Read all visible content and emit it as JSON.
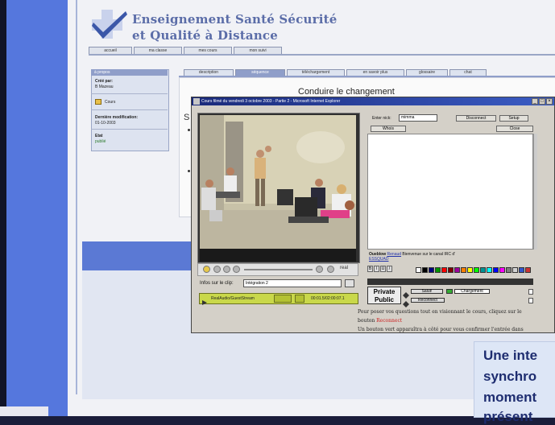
{
  "site": {
    "title_line1": "Enseignement Santé Sécurité",
    "title_line2": "et Qualité à Distance"
  },
  "top_nav": [
    "accueil",
    "ma classe",
    "mes cours",
    "mon suivi"
  ],
  "sidebar": {
    "header": "à propos",
    "created_by_label": "Créé par:",
    "created_by_value": "B Mazeau",
    "course_label": "Cours",
    "last_modified_label": "Dernière modification:",
    "last_modified_value": "01-10-2003",
    "status_label": "Etat",
    "status_value": "publié"
  },
  "sub_tabs": [
    "description",
    "séquence",
    "téléchargement",
    "en savoir plus",
    "glossaire",
    "chat"
  ],
  "content": {
    "title": "Conduire le changement",
    "section_initial": "S"
  },
  "popup": {
    "title": "Cours filmé du vendredi 3 octobre 2003 - Partie 2 - Microsoft Internet Explorer",
    "real_label": "real",
    "clip_label": "Infos sur le clip:",
    "clip_value": "Intégration 2",
    "status_left": "RealAudio/GuestStream",
    "status_right": "00:01.5/02:00:07.1"
  },
  "chat": {
    "nick_label": "Enter nick:",
    "nick_value": "mimma",
    "disconnect_label": "Disconnect",
    "setup_label": "Setup",
    "who_label": "Whois",
    "close_label": "Close",
    "msg_prefix": "Oueblow",
    "msg_nick": "Renaud",
    "msg_body": "Bienvenue sur le canal IRC d'",
    "msg_link": "ESSQUAD",
    "private_line1": "Private",
    "private_line2": "Public",
    "pill_top_left": "Salut!",
    "pill_top_right": "Chargement",
    "pill_bottom": "Reconnect"
  },
  "info": {
    "line1": "Pour poser vos questions tout en visionnant le cours, cliquez sur le",
    "line2_pre": "bouton ",
    "line2_red": "Reconnect",
    "line3": "Un bouton vert apparaîtra à côté pour vous confirmer l'entrée dans"
  },
  "promo": {
    "line1": "Une inte",
    "line2": "synchro",
    "line3": "moment",
    "line4": "présent"
  },
  "colors": {
    "accent_blue": "#5b79d4",
    "title_blue": "#5b6da8",
    "status_green": "#c9d84a",
    "promo_text": "#1e2d70"
  }
}
